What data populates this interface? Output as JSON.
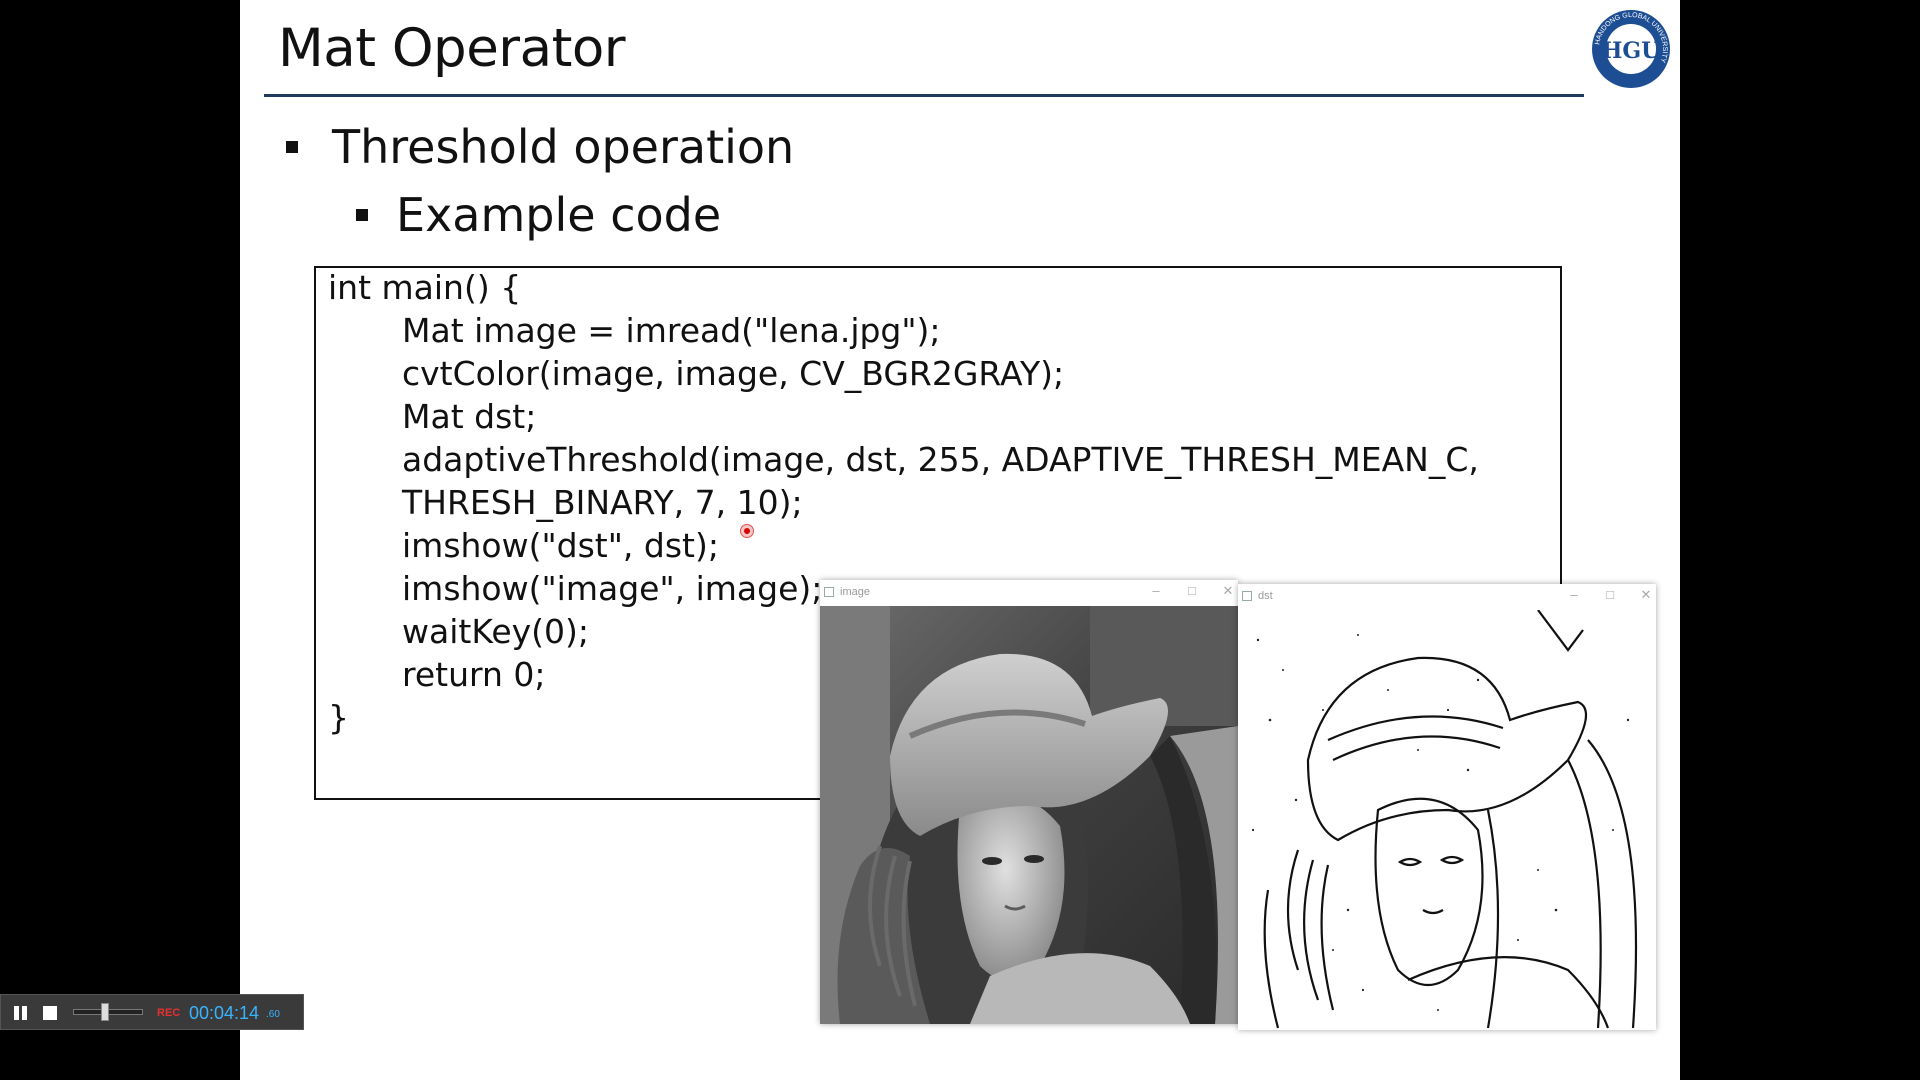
{
  "slide": {
    "title": "Mat Operator",
    "bullet1": "Threshold operation",
    "bullet2": "Example code",
    "logo_text": "HGU",
    "logo_ring_text": "HANDONG GLOBAL UNIVERSITY"
  },
  "code": [
    "int main() {",
    "Mat image = imread(\"lena.jpg\");",
    "cvtColor(image, image, CV_BGR2GRAY);",
    "Mat dst;",
    "adaptiveThreshold(image, dst, 255, ADAPTIVE_THRESH_MEAN_C,",
    "THRESH_BINARY, 7, 10);",
    "imshow(\"dst\", dst);",
    "imshow(\"image\", image);",
    "waitKey(0);",
    "return 0;",
    "}"
  ],
  "windows": {
    "image": {
      "title": "image",
      "minimize": "–",
      "maximize": "□",
      "close": "✕"
    },
    "dst": {
      "title": "dst",
      "minimize": "–",
      "maximize": "□",
      "close": "✕"
    }
  },
  "recorder": {
    "rec_label": "REC",
    "time": "00:04:14",
    "sub": ".60"
  },
  "colors": {
    "title_rule": "#1f3a5f",
    "logo_blue": "#1d4e94",
    "rec_red": "#e53030",
    "rec_time": "#38b4ff"
  }
}
